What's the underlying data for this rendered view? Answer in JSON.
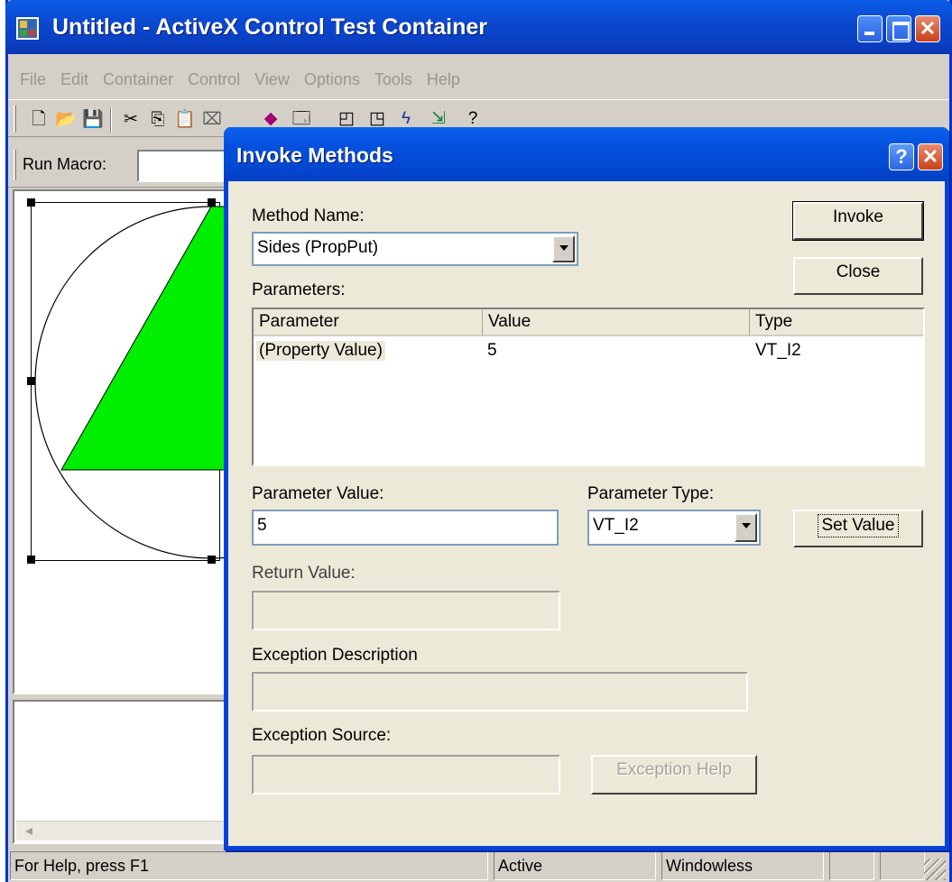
{
  "main_window": {
    "title": "Untitled - ActiveX Control Test Container",
    "menu": [
      "File",
      "Edit",
      "Container",
      "Control",
      "View",
      "Options",
      "Tools",
      "Help"
    ],
    "toolbar_icons": [
      "new-file-icon",
      "open-folder-icon",
      "save-icon",
      "cut-icon",
      "copy-icon",
      "paste-icon",
      "delete-icon",
      "insert-control-icon",
      "properties-icon",
      "design-mode-icon",
      "control-window-icon",
      "invoke-methods-icon",
      "event-log-icon",
      "about-icon"
    ],
    "run_macro_label": "Run Macro:",
    "run_macro_value": ""
  },
  "control": {
    "triangle_color": "#00ee00",
    "circle_color": "#000000",
    "sides": 5
  },
  "status_bar": {
    "help_text": "For Help, press F1",
    "mode": "Active",
    "windowing": "Windowless"
  },
  "dialog": {
    "title": "Invoke Methods",
    "method_name_label": "Method Name:",
    "method_name_value": "Sides (PropPut)",
    "invoke_button": "Invoke",
    "close_button": "Close",
    "parameters_label": "Parameters:",
    "parameters": {
      "columns": [
        "Parameter",
        "Value",
        "Type"
      ],
      "rows": [
        {
          "parameter": "(Property Value)",
          "value": "5",
          "type": "VT_I2"
        }
      ]
    },
    "parameter_value_label": "Parameter Value:",
    "parameter_value": "5",
    "parameter_type_label": "Parameter Type:",
    "parameter_type_value": "VT_I2",
    "set_value_button": "Set Value",
    "return_value_label": "Return Value:",
    "return_value": "",
    "exception_description_label": "Exception Description",
    "exception_description": "",
    "exception_source_label": "Exception Source:",
    "exception_source": "",
    "exception_help_button": "Exception Help"
  },
  "colors": {
    "title_bar": "#0a4fd6",
    "dialog_face": "#ece9d8",
    "window_face": "#d4d0c8",
    "close_button": "#d2532b"
  }
}
